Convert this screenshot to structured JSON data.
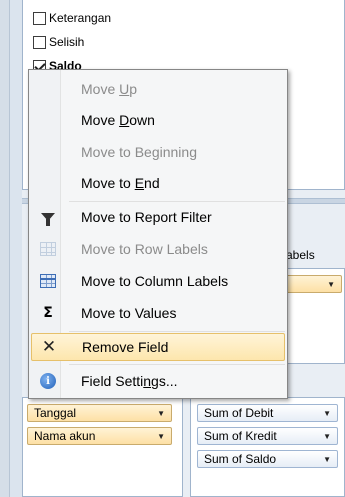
{
  "field_list": {
    "fields": [
      {
        "label": "Keterangan",
        "checked": false,
        "bold": false
      },
      {
        "label": "Selisih",
        "checked": false,
        "bold": false
      },
      {
        "label": "Saldo",
        "checked": true,
        "bold": true
      }
    ]
  },
  "context_menu": {
    "items": [
      {
        "pre": "Move ",
        "key": "U",
        "post": "p",
        "disabled": true,
        "icon": ""
      },
      {
        "pre": "Move ",
        "key": "D",
        "post": "own",
        "disabled": false,
        "icon": ""
      },
      {
        "pre": "Move to Be",
        "key": "g",
        "post": "inning",
        "disabled": true,
        "icon": ""
      },
      {
        "pre": "Move to ",
        "key": "E",
        "post": "nd",
        "disabled": false,
        "icon": ""
      },
      {
        "pre": "Move to Report Filter",
        "key": "",
        "post": "",
        "disabled": false,
        "icon": "filter-icon"
      },
      {
        "pre": "Move to Row Labels",
        "key": "",
        "post": "",
        "disabled": true,
        "icon": "row-labels-icon"
      },
      {
        "pre": "Move to Column Labels",
        "key": "",
        "post": "",
        "disabled": false,
        "icon": "column-labels-icon"
      },
      {
        "pre": "Move to Values",
        "key": "",
        "post": "",
        "disabled": false,
        "icon": "sigma-icon"
      },
      {
        "pre": "Remove Field",
        "key": "",
        "post": "",
        "disabled": false,
        "icon": "remove-icon"
      },
      {
        "pre": "Field Setti",
        "key": "n",
        "post": "gs...",
        "disabled": false,
        "icon": "field-settings-icon"
      }
    ]
  },
  "areas": {
    "column_labels_header": "abels",
    "row_fields": [
      {
        "label": "Tanggal"
      },
      {
        "label": "Nama akun"
      }
    ],
    "value_fields": [
      {
        "label": "Sum of Debit"
      },
      {
        "label": "Sum of Kredit"
      },
      {
        "label": "Sum of Saldo"
      }
    ]
  }
}
